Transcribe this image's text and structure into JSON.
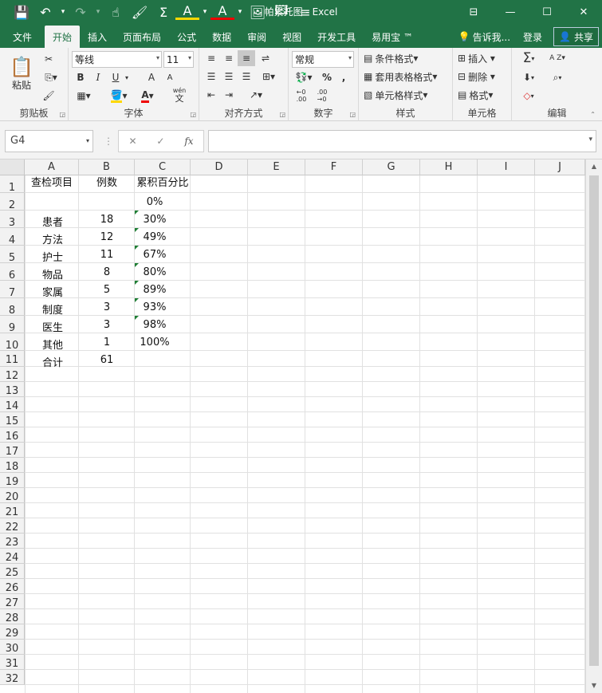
{
  "titlebar": {
    "title": "帕累托图 - Excel",
    "quick_access": {
      "save_icon": "💾",
      "undo_icon": "↶",
      "redo_icon": "↷",
      "touch_icon": "☝",
      "brush_icon": "🖌",
      "sum_icon": "Σ",
      "fill_icon": "A",
      "fontcolor_icon": "A",
      "picture_icon": "🖼",
      "chart_icon": "🖾",
      "more_icon": "≡"
    },
    "window": {
      "ribbon_display": "⊟",
      "minimize": "—",
      "restore": "☐",
      "close": "✕"
    }
  },
  "tabs": [
    "文件",
    "开始",
    "插入",
    "页面布局",
    "公式",
    "数据",
    "审阅",
    "视图",
    "开发工具",
    "易用宝 ™"
  ],
  "active_tab": "开始",
  "tell_me": "告诉我...",
  "login": "登录",
  "share": "共享",
  "ribbon": {
    "clipboard": {
      "paste_label": "粘贴",
      "group_label": "剪贴板"
    },
    "font": {
      "font_name": "等线",
      "font_size": "11",
      "bold": "B",
      "italic": "I",
      "underline": "U",
      "grow": "A",
      "shrink": "A",
      "wen": "wén",
      "wen_char": "文",
      "group_label": "字体"
    },
    "alignment": {
      "group_label": "对齐方式"
    },
    "number": {
      "format": "常规",
      "percent": "%",
      "comma": ",",
      "group_label": "数字"
    },
    "styles": {
      "conditional": "条件格式",
      "table": "套用表格格式",
      "cell": "单元格样式",
      "group_label": "样式"
    },
    "cells": {
      "insert": "插入",
      "delete": "删除",
      "format": "格式",
      "group_label": "单元格"
    },
    "editing": {
      "sum": "Σ",
      "sort": "A Z",
      "find": "⌕",
      "clear": "◇",
      "group_label": "编辑"
    }
  },
  "formula_bar": {
    "name_box": "G4",
    "cancel": "✕",
    "enter": "✓",
    "fx": "fx",
    "formula": ""
  },
  "sheet": {
    "columns": [
      "A",
      "B",
      "C",
      "D",
      "E",
      "F",
      "G",
      "H",
      "I",
      "J"
    ],
    "rows": [
      [
        "查检项目",
        "例数",
        "累积百分比"
      ],
      [
        "",
        "",
        "0%"
      ],
      [
        "患者",
        "18",
        "30%"
      ],
      [
        "方法",
        "12",
        "49%"
      ],
      [
        "护士",
        "11",
        "67%"
      ],
      [
        "物品",
        "8",
        "80%"
      ],
      [
        "家属",
        "5",
        "89%"
      ],
      [
        "制度",
        "3",
        "93%"
      ],
      [
        "医生",
        "3",
        "98%"
      ],
      [
        "其他",
        "1",
        "100%"
      ],
      [
        "合计",
        "61",
        ""
      ]
    ],
    "error_indicator_rows": [
      3,
      4,
      5,
      6,
      7,
      8,
      9
    ],
    "row_count": 32
  }
}
